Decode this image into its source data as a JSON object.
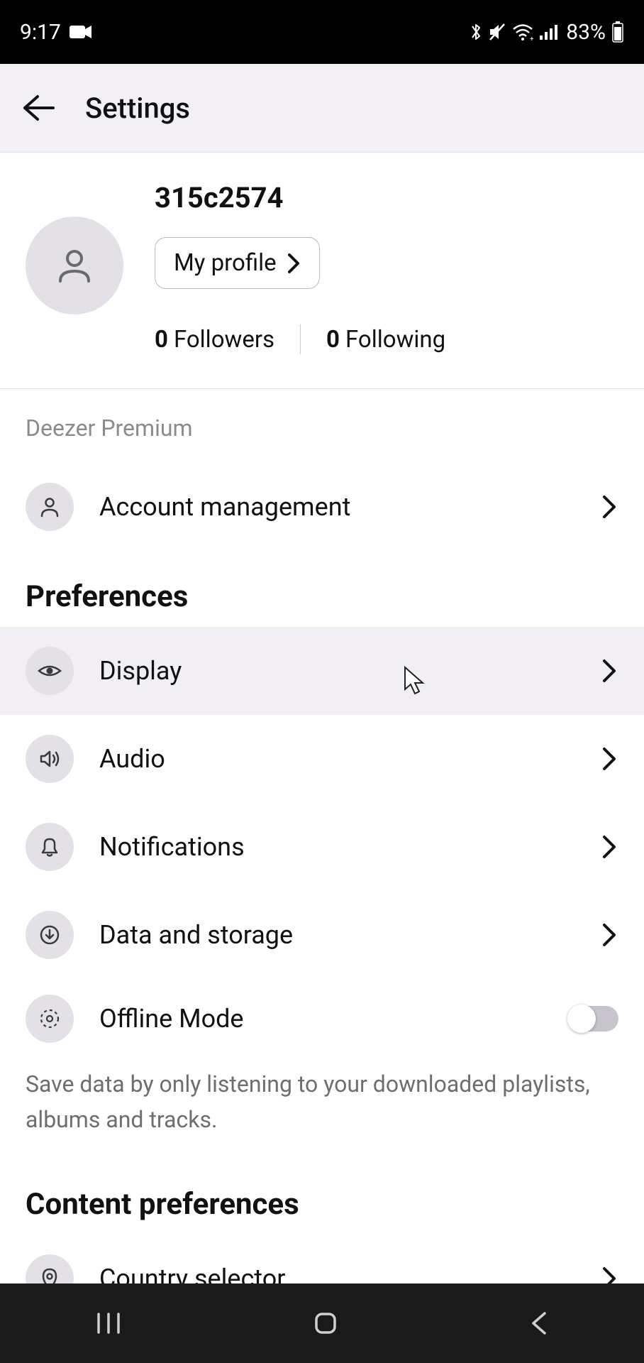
{
  "status": {
    "time": "9:17",
    "battery": "83%"
  },
  "header": {
    "title": "Settings"
  },
  "profile": {
    "username": "315c2574",
    "button_label": "My profile",
    "followers_count": "0",
    "followers_label": "Followers",
    "following_count": "0",
    "following_label": "Following"
  },
  "subscription": {
    "plan": "Deezer Premium",
    "account_label": "Account management"
  },
  "preferences": {
    "title": "Preferences",
    "display": "Display",
    "audio": "Audio",
    "notifications": "Notifications",
    "data_storage": "Data and storage",
    "offline_mode": "Offline Mode",
    "offline_desc": "Save data by only listening to your downloaded playlists, albums and tracks.",
    "offline_on": false
  },
  "content_prefs": {
    "title": "Content preferences",
    "country_selector": "Country selector"
  }
}
